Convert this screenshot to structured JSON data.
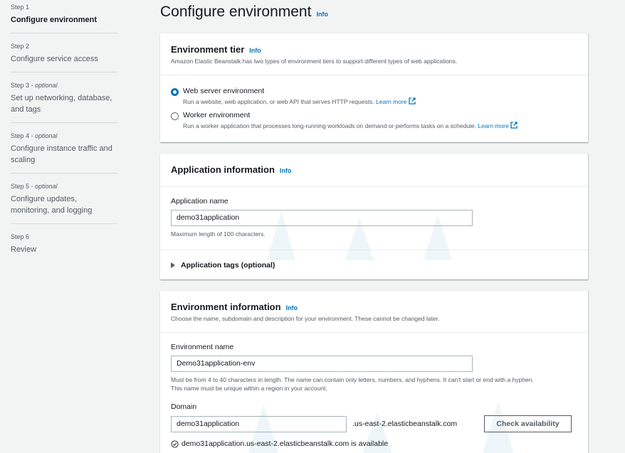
{
  "sidebar": {
    "steps": [
      {
        "num": "Step 1",
        "optional": "",
        "title": "Configure environment",
        "active": true
      },
      {
        "num": "Step 2",
        "optional": "",
        "title": "Configure service access",
        "active": false
      },
      {
        "num": "Step 3",
        "optional": " - optional",
        "title": "Set up networking, database, and tags",
        "active": false
      },
      {
        "num": "Step 4",
        "optional": " - optional",
        "title": "Configure instance traffic and scaling",
        "active": false
      },
      {
        "num": "Step 5",
        "optional": " - optional",
        "title": "Configure updates, monitoring, and logging",
        "active": false
      },
      {
        "num": "Step 6",
        "optional": "",
        "title": "Review",
        "active": false
      }
    ]
  },
  "page": {
    "title": "Configure environment",
    "info": "Info"
  },
  "tier": {
    "title": "Environment tier",
    "info": "Info",
    "desc": "Amazon Elastic Beanstalk has two types of environment tiers to support different types of web applications.",
    "options": [
      {
        "label": "Web server environment",
        "desc": "Run a website, web application, or web API that serves HTTP requests.",
        "learn": "Learn more",
        "checked": true
      },
      {
        "label": "Worker environment",
        "desc": "Run a worker application that processes long-running workloads on demand or performs tasks on a schedule.",
        "learn": "Learn more",
        "checked": false
      }
    ]
  },
  "app": {
    "title": "Application information",
    "info": "Info",
    "name_label": "Application name",
    "name_value": "demo31application",
    "name_hint": "Maximum length of 100 characters.",
    "tags_label": "Application tags (optional)"
  },
  "env": {
    "title": "Environment information",
    "info": "Info",
    "desc": "Choose the name, subdomain and description for your environment. These cannot be changed later.",
    "name_label": "Environment name",
    "name_value": "Demo31application-env",
    "name_hint_1": "Must be from 4 to 40 characters in length. The name can contain only letters, numbers, and hyphens. It can't start or end with a hyphen.",
    "name_hint_2": "This name must be unique within a region in your account.",
    "domain_label": "Domain",
    "domain_value": "demo31application",
    "domain_suffix": ".us-east-2.elasticbeanstalk.com",
    "check_button": "Check availability",
    "available_text": "demo31application.us-east-2.elasticbeanstalk.com is available"
  },
  "colors": {
    "accent": "#0073bb",
    "text": "#16191f",
    "muted": "#545b64",
    "background": "#f2f3f3"
  }
}
